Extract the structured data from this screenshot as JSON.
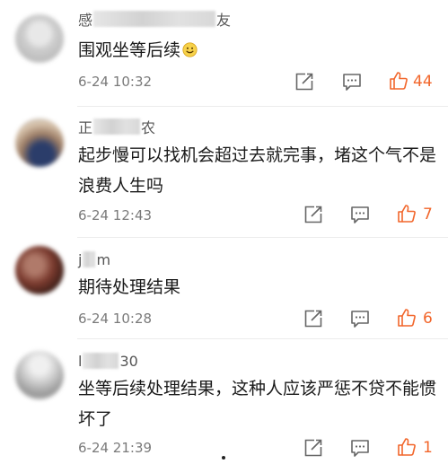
{
  "comments": [
    {
      "name_start": "感",
      "name_end": "友",
      "text": "围观坐等后续",
      "emoji": "smile-emoji",
      "time": "6-24 10:32",
      "likes": "44"
    },
    {
      "name_start": "正",
      "name_end": "农",
      "text": "起步慢可以找机会超过去就完事，堵这个气不是浪费人生吗",
      "time": "6-24 12:43",
      "likes": "7"
    },
    {
      "name_start": "j",
      "name_end": "m",
      "text": "期待处理结果",
      "time": "6-24 10:28",
      "likes": "6"
    },
    {
      "name_start": "l",
      "name_end": "30",
      "text": "坐等后续处理结果，这种人应该严惩不贷不能惯坏了",
      "time": "6-24 21:39",
      "likes": "1"
    }
  ],
  "icons": {
    "share": "share-icon",
    "reply": "reply-icon",
    "like": "thumbs-up-icon"
  },
  "colors": {
    "like_accent": "#f2662b",
    "text": "#1a1a1a",
    "meta": "#7a7a7a"
  }
}
